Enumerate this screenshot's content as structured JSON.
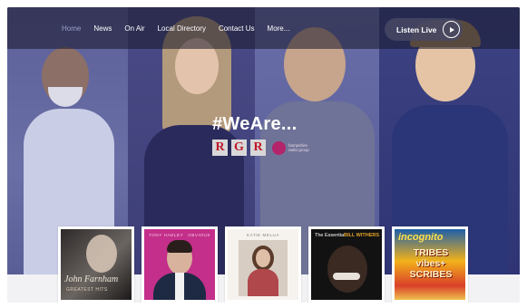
{
  "nav": {
    "items": [
      {
        "label": "Home",
        "active": true
      },
      {
        "label": "News",
        "active": false
      },
      {
        "label": "On Air",
        "active": false
      },
      {
        "label": "Local Directory",
        "active": false
      },
      {
        "label": "Contact Us",
        "active": false
      },
      {
        "label": "More...",
        "active": false
      }
    ],
    "listen_label": "Listen Live"
  },
  "hero": {
    "headline": "#WeAre...",
    "brand_letters": [
      "R",
      "G",
      "R"
    ],
    "partner_text": "hampshire radio group"
  },
  "albums": [
    {
      "cover_text": "John Farnham",
      "cover_subtext": "GREATEST HITS"
    },
    {
      "cover_text": "TONY HADLEY",
      "cover_subtext": "OBVIOUS"
    },
    {
      "cover_text": "KATIE MELUA",
      "cover_subtext": ""
    },
    {
      "cover_text": "The Essential",
      "cover_subtext": "BILL WITHERS"
    },
    {
      "cover_text": "incognito",
      "cover_subtext": "TRIBES vibes+ SCRIBES"
    }
  ],
  "colors": {
    "accent_red": "#c0182a",
    "partner_pink": "#b3246b",
    "nav_active": "#9aa0c8"
  }
}
